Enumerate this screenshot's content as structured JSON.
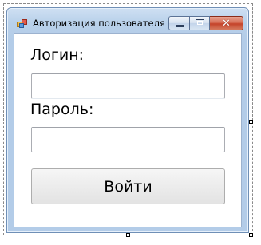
{
  "window": {
    "title": "Авторизация пользователя",
    "icon": "app-form-icon",
    "buttons": {
      "minimize": "minimize-icon",
      "maximize": "maximize-icon",
      "close": "close-icon",
      "close_glyph": "✕"
    }
  },
  "form": {
    "login_label": "Логин:",
    "login_value": "",
    "password_label": "Пароль:",
    "password_value": "",
    "submit_label": "Войти"
  },
  "colors": {
    "close_button": "#c4432a",
    "frame": "#b3cce8"
  }
}
